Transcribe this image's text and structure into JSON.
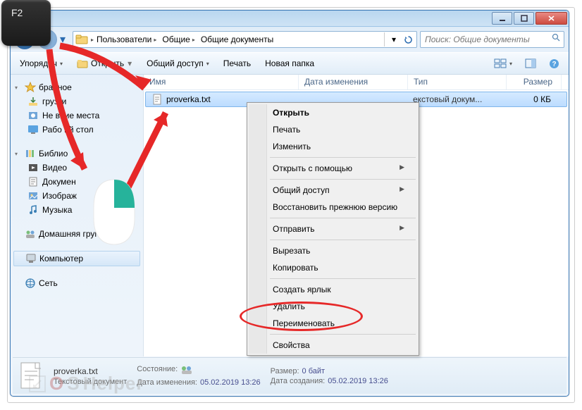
{
  "key_overlay": "F2",
  "breadcrumbs": [
    "Пользователи",
    "Общие",
    "Общие документы"
  ],
  "search_placeholder": "Поиск: Общие документы",
  "toolbar": {
    "organize": "Упорядоч",
    "open": "Открыть",
    "share": "Общий доступ",
    "print": "Печать",
    "newfolder": "Новая папка"
  },
  "sidebar": {
    "favorites": "бранное",
    "fav_items": [
      "грузки",
      "Не    вние места",
      "Рабо    ий стол"
    ],
    "libraries": "Библио",
    "lib_items": [
      "Видео",
      "Докумен",
      "Изображ",
      "Музыка"
    ],
    "homegroup": "Домашняя группа",
    "computer": "Компьютер",
    "network": "Сеть"
  },
  "columns": {
    "name": "Имя",
    "date": "Дата изменения",
    "type": "Тип",
    "size": "Размер"
  },
  "file": {
    "name": "proverka.txt",
    "date": "",
    "type": "екстовый докум...",
    "size": "0 КБ"
  },
  "context_menu": {
    "open": "Открыть",
    "print": "Печать",
    "edit": "Изменить",
    "openwith": "Открыть с помощью",
    "share": "Общий доступ",
    "restore": "Восстановить прежнюю версию",
    "sendto": "Отправить",
    "cut": "Вырезать",
    "copy": "Копировать",
    "shortcut": "Создать ярлык",
    "delete": "Удалить",
    "rename": "Переименовать",
    "properties": "Свойства"
  },
  "status": {
    "filename": "proverka.txt",
    "filetype": "Текстовый документ",
    "state_label": "Состояние:",
    "state_icon": "shared",
    "modified_label": "Дата изменения:",
    "modified": "05.02.2019 13:26",
    "size_label": "Размер:",
    "size": "0 байт",
    "created_label": "Дата создания:",
    "created": "05.02.2019 13:26"
  },
  "watermark": {
    "part1": "O",
    "part2": "S",
    "part3": "Helper"
  }
}
